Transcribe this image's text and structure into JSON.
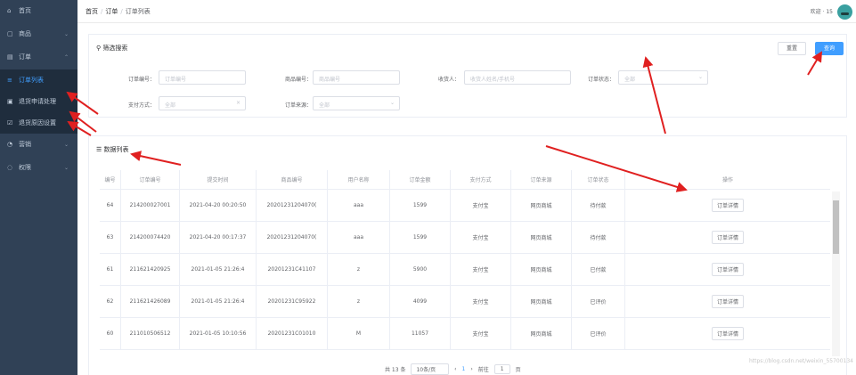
{
  "sidebar": {
    "items": [
      {
        "icon": "home-icon",
        "glyph": "⌂",
        "label": "首页",
        "chev": ""
      },
      {
        "icon": "product-icon",
        "glyph": "▢",
        "label": "商品",
        "chev": "⌄"
      },
      {
        "icon": "order-icon",
        "glyph": "▤",
        "label": "订单",
        "chev": "⌃"
      },
      {
        "icon": "order-list-icon",
        "glyph": "≡",
        "label": "订单列表",
        "chev": ""
      },
      {
        "icon": "return-apply-icon",
        "glyph": "▣",
        "label": "退货申请处理",
        "chev": ""
      },
      {
        "icon": "return-reason-icon",
        "glyph": "☑",
        "label": "退货原因设置",
        "chev": ""
      },
      {
        "icon": "marketing-icon",
        "glyph": "◔",
        "label": "营销",
        "chev": "⌄"
      },
      {
        "icon": "permission-icon",
        "glyph": "◌",
        "label": "权限",
        "chev": "⌄"
      }
    ]
  },
  "header": {
    "breadcrumb": [
      "首页",
      "订单",
      "订单列表"
    ],
    "user": "欢迎 · 15"
  },
  "search": {
    "title": "筛选搜索",
    "reset": "重置",
    "submit": "查询",
    "fields": {
      "order_no": {
        "label": "订单编号：",
        "placeholder": "订单编号"
      },
      "receiver_no": {
        "label": "商品编号：",
        "placeholder": "商品编号"
      },
      "receiver": {
        "label": "收货人：",
        "placeholder": "收货人姓名/手机号"
      },
      "status": {
        "label": "订单状态：",
        "value": "全部"
      },
      "pay_type": {
        "label": "支付方式：",
        "value": "全部"
      },
      "source": {
        "label": "订单来源：",
        "value": "全部"
      }
    }
  },
  "list": {
    "title": "数据列表",
    "columns": [
      "编号",
      "订单编号",
      "提交时间",
      "商品编号",
      "用户名称",
      "订单金额",
      "支付方式",
      "订单来源",
      "订单状态",
      "操作"
    ],
    "rows": [
      [
        "64",
        "214200027001",
        "2021-04-20 00:20:50",
        "20201231204070(",
        "aaa",
        "1599",
        "支付宝",
        "网页商城",
        "待付款",
        "订单详情"
      ],
      [
        "63",
        "214200074420",
        "2021-04-20 00:17:37",
        "20201231204070(",
        "aaa",
        "1599",
        "支付宝",
        "网页商城",
        "待付款",
        "订单详情"
      ],
      [
        "61",
        "211621420925",
        "2021-01-05 21:26:4",
        "20201231C41107",
        "z",
        "5900",
        "支付宝",
        "网页商城",
        "已付款",
        "订单详情"
      ],
      [
        "62",
        "211621426089",
        "2021-01-05 21:26:4",
        "20201231C95922",
        "z",
        "4099",
        "支付宝",
        "网页商城",
        "已评价",
        "订单详情"
      ],
      [
        "60",
        "211010506512",
        "2021-01-05 10:10:56",
        "20201231C01010",
        "M",
        "11057",
        "支付宝",
        "网页商城",
        "已评价",
        "订单详情"
      ]
    ]
  },
  "pager": {
    "total": "共 13 条",
    "size": "10条/页",
    "prev": "‹",
    "page": "1",
    "next": "›",
    "goto": "前往",
    "goto_val": "1",
    "goto_unit": "页"
  },
  "watermark": "https://blog.csdn.net/weixin_55700134",
  "colors": {
    "sidebar": "#304156",
    "accent": "#409eff",
    "arrow": "#e02020"
  }
}
